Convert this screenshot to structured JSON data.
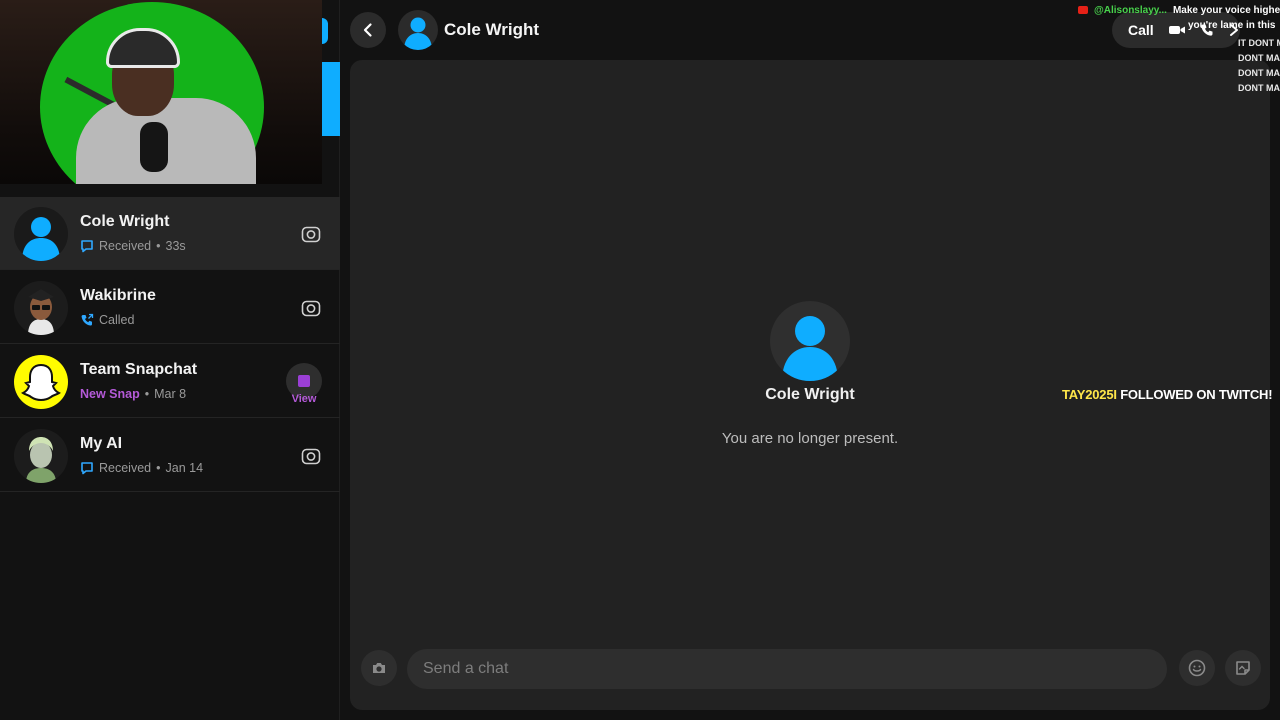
{
  "colors": {
    "accent_blue": "#0fadff",
    "snap_purple": "#9b3fd6",
    "snapchat_yellow": "#fffc00",
    "background": "#121212",
    "panel": "#222222"
  },
  "chats": [
    {
      "name": "Cole Wright",
      "status_icon": "chat-bubble-icon",
      "status": "Received",
      "time": "33s",
      "action_icon": "camera-icon",
      "active": true
    },
    {
      "name": "Wakibrine",
      "status_icon": "phone-call-icon",
      "status": "Called",
      "time": "",
      "action_icon": "camera-icon",
      "active": false
    },
    {
      "name": "Team Snapchat",
      "status_icon": "",
      "status": "New Snap",
      "time": "Mar 8",
      "action_icon": "snap-square-icon",
      "action_label": "View",
      "active": false
    },
    {
      "name": "My AI",
      "status_icon": "chat-bubble-icon",
      "status": "Received",
      "time": "Jan 14",
      "action_icon": "camera-icon",
      "active": false
    }
  ],
  "header": {
    "name": "Cole Wright",
    "call_label": "Call",
    "back_icon": "chevron-left-icon",
    "call_icons": [
      "video-camera-icon",
      "phone-icon",
      "chevron-right-icon"
    ]
  },
  "main": {
    "name": "Cole Wright",
    "note": "You are no longer present."
  },
  "composer": {
    "placeholder": "Send a chat",
    "camera_icon": "camera-icon",
    "emoji_icon": "smiley-icon",
    "sticker_icon": "sticker-icon"
  },
  "stream_overlay": {
    "chat_lines": [
      {
        "user": "@Alisonslayy...",
        "message": "Make your voice higher"
      },
      {
        "user": "",
        "message": "you're lame in this"
      }
    ],
    "spam": [
      "IT DONT M",
      "DONT MA",
      "DONT MA",
      "DONT MA"
    ],
    "follow_user": "TAY2025I",
    "follow_text": " FOLLOWED ON TWITCH!"
  }
}
